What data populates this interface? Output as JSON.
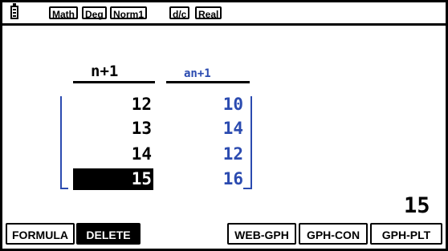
{
  "status": {
    "modes": [
      "Math",
      "Deg",
      "Norm1",
      "d/c",
      "Real"
    ]
  },
  "table": {
    "col1_header": "n+1",
    "col2_header": "an+1",
    "col1": [
      "12",
      "13",
      "14",
      "15"
    ],
    "col2": [
      "10",
      "14",
      "12",
      "16"
    ],
    "selected_row": 3
  },
  "current_value": "15",
  "fkeys": {
    "formula": "FORMULA",
    "delete": "DELETE",
    "web_gph": "WEB-GPH",
    "gph_con": "GPH-CON",
    "gph_plt": "GPH-PLT"
  },
  "colors": {
    "accent_blue": "#2b4bb0",
    "foreground": "#000000",
    "background": "#ffffff"
  }
}
